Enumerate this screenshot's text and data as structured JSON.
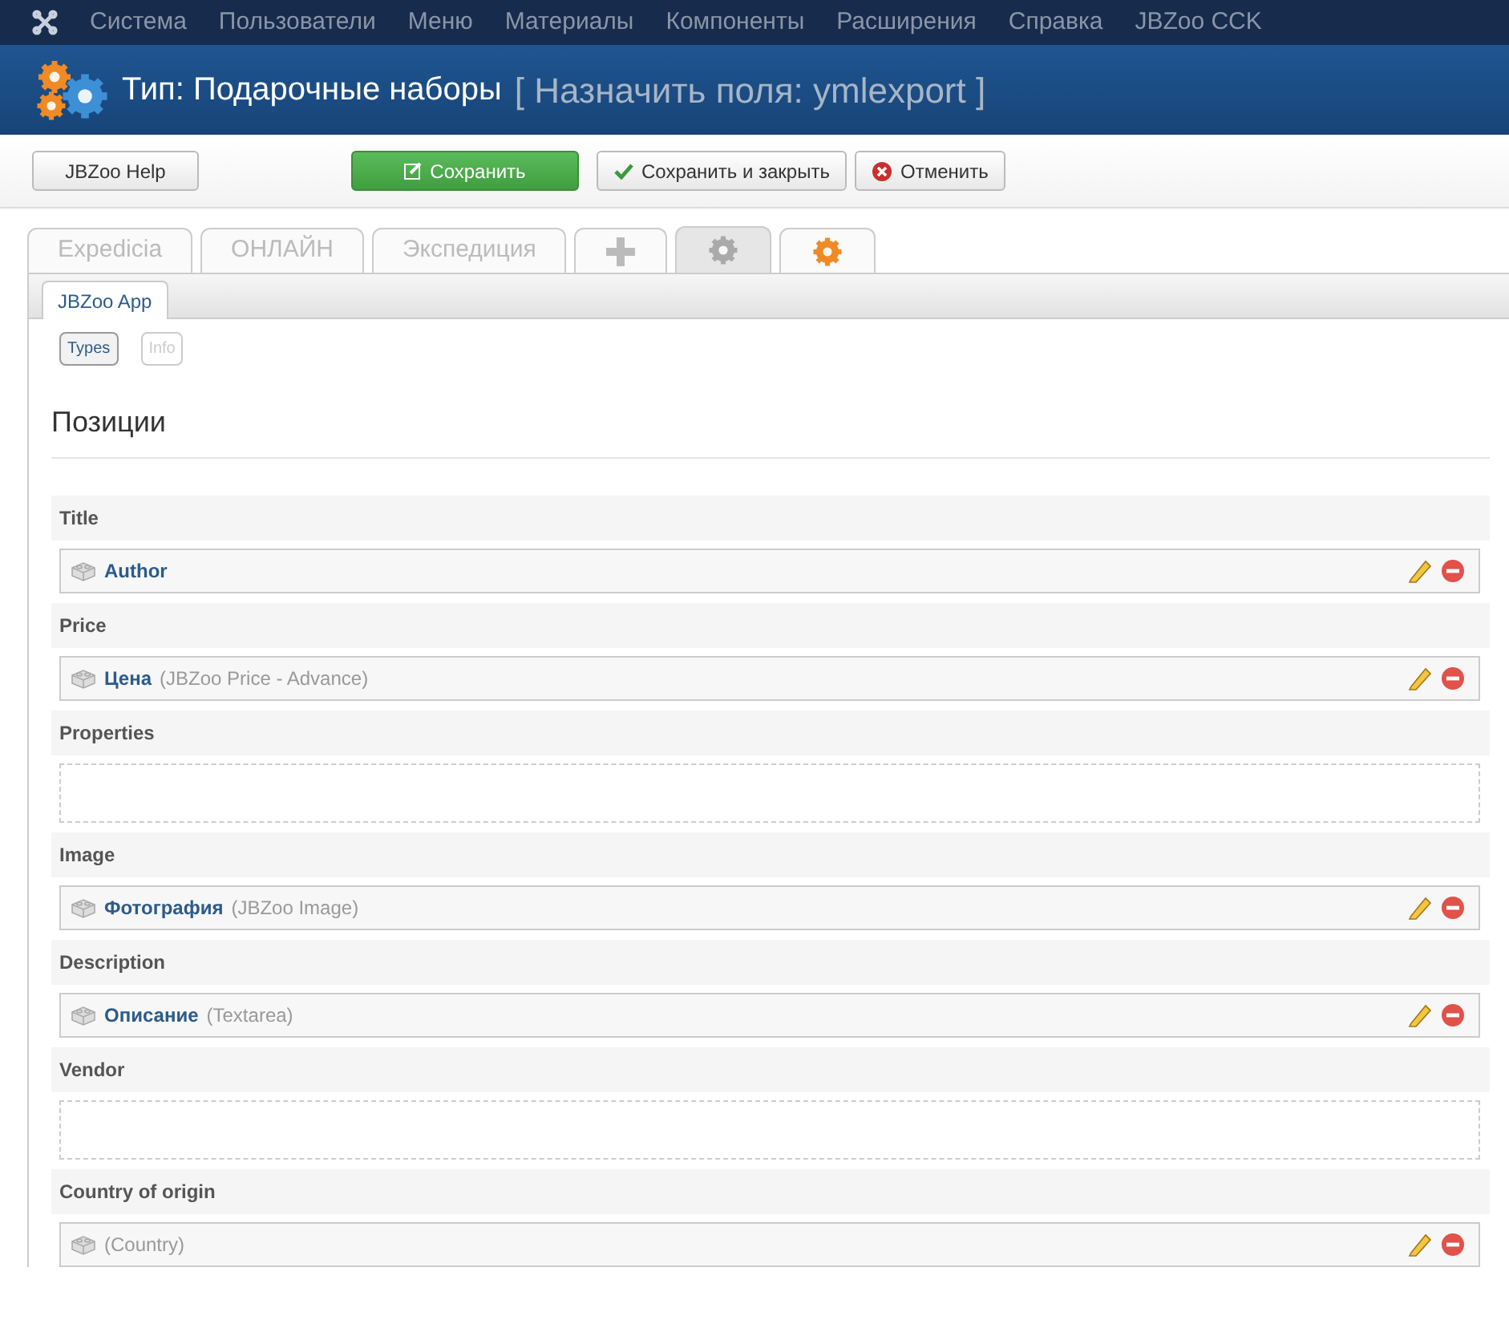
{
  "menu": [
    "Система",
    "Пользователи",
    "Меню",
    "Материалы",
    "Компоненты",
    "Расширения",
    "Справка",
    "JBZoo CCK"
  ],
  "header": {
    "title": "Тип: Подарочные наборы",
    "subtitle": "[ Назначить поля: ymlexport ]"
  },
  "toolbar": [
    {
      "kind": "help",
      "label": "JBZoo Help"
    },
    {
      "kind": "save",
      "label": "Сохранить"
    },
    {
      "kind": "save-close",
      "label": "Сохранить и закрыть"
    },
    {
      "kind": "cancel",
      "label": "Отменить"
    }
  ],
  "app_tabs": [
    {
      "kind": "text",
      "label": "Expedicia",
      "selected": false
    },
    {
      "kind": "text",
      "label": "ОНЛАЙН",
      "selected": false
    },
    {
      "kind": "text",
      "label": "Экспедиция",
      "selected": false
    },
    {
      "kind": "plus",
      "selected": false
    },
    {
      "kind": "gear",
      "selected": true
    },
    {
      "kind": "orange-gear",
      "selected": false
    }
  ],
  "sub_tabs": [
    {
      "label": "JBZoo App",
      "selected": true
    }
  ],
  "pills": [
    {
      "label": "Types",
      "selected": true
    },
    {
      "label": "Info",
      "selected": false
    }
  ],
  "section_title": "Позиции",
  "positions": [
    {
      "label": "Title",
      "fields": [
        {
          "name": "Author"
        }
      ]
    },
    {
      "label": "Price",
      "fields": [
        {
          "name": "Цена",
          "type": "(JBZoo Price - Advance)"
        }
      ]
    },
    {
      "label": "Properties"
    },
    {
      "label": "Image",
      "fields": [
        {
          "name": "Фотография",
          "type": "(JBZoo Image)"
        }
      ]
    },
    {
      "label": "Description",
      "fields": [
        {
          "name": "Описание",
          "type": "(Textarea)"
        }
      ]
    },
    {
      "label": "Vendor"
    },
    {
      "label": "Country of origin",
      "fields": [
        {
          "type": "(Country)"
        }
      ]
    }
  ]
}
